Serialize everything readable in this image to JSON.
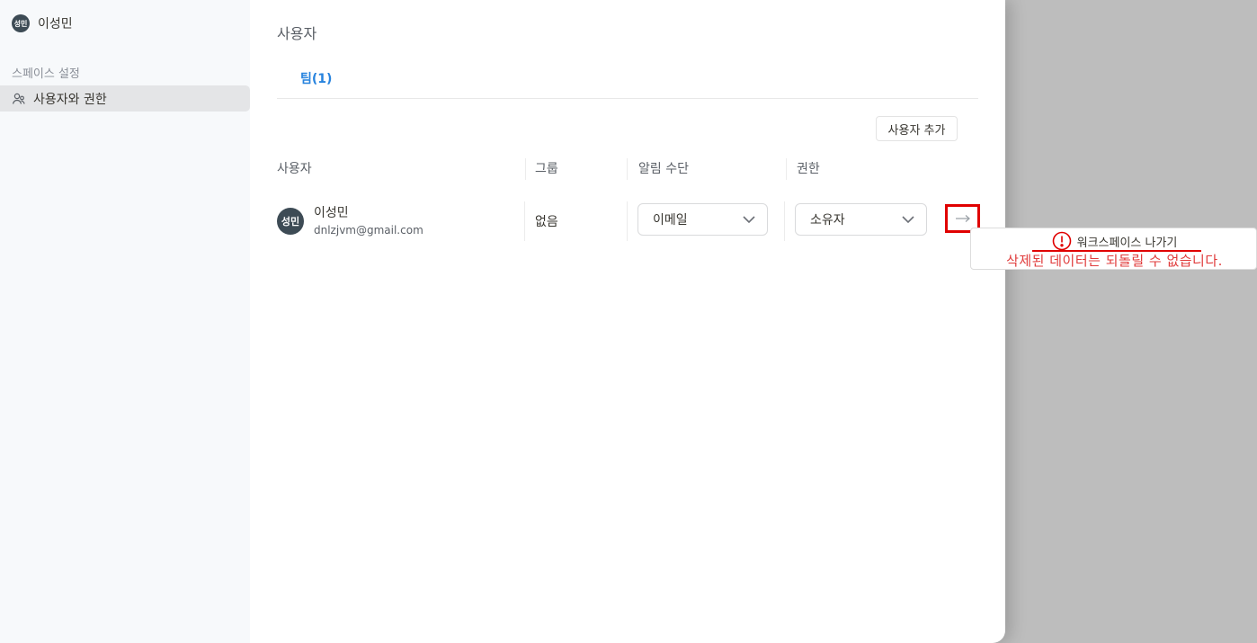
{
  "sidebar": {
    "user": {
      "avatar_text": "성민",
      "name": "이성민"
    },
    "section_label": "스페이스 설정",
    "items": [
      {
        "label": "사용자와 권한",
        "icon": "users-icon",
        "active": true
      }
    ]
  },
  "main": {
    "title": "사용자",
    "tabs": [
      {
        "label": "팀(1)",
        "active": true
      }
    ],
    "add_user_label": "사용자 추가",
    "table": {
      "headers": [
        "사용자",
        "그룹",
        "알림 수단",
        "권한"
      ],
      "rows": [
        {
          "avatar_text": "성민",
          "name": "이성민",
          "email": "dnlzjvm@gmail.com",
          "group": "없음",
          "notification": "이메일",
          "role": "소유자"
        }
      ]
    }
  },
  "tooltip": {
    "title": "워크스페이스 나가기",
    "description": "삭제된 데이터는 되돌릴 수 없습니다.",
    "icon": "alert-circle-icon"
  },
  "colors": {
    "accent": "#2783de",
    "avatar_bg": "#3d4b55",
    "highlight_red": "#e00000",
    "warning_text": "#e03b3b",
    "backdrop": "#bdbdbd"
  }
}
